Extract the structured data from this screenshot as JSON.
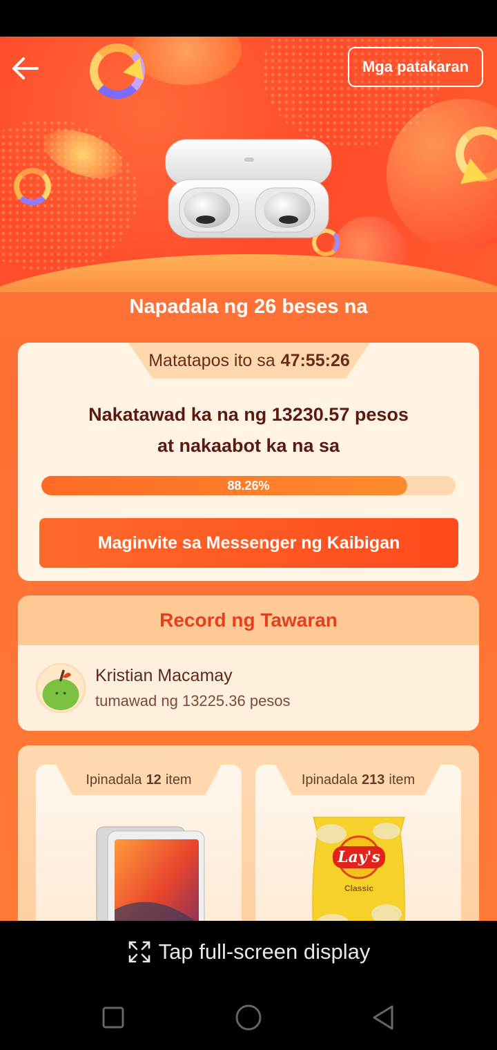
{
  "header": {
    "rules_label": "Mga patakaran"
  },
  "hero": {
    "sent_text": "Napadala ng 26 beses na"
  },
  "bargain": {
    "timer_prefix": "Matatapos ito sa",
    "timer_value": "47:55:26",
    "line1": "Nakatawad ka na ng 13230.57 pesos",
    "line2": "at nakaabot ka na sa",
    "progress_percent": 88.26,
    "progress_label": "88.26%",
    "invite_label": "Maginvite sa Messenger ng Kaibigan"
  },
  "records": {
    "title": "Record ng Tawaran",
    "items": [
      {
        "name": "Kristian Macamay",
        "amount_text": "tumawad ng 13225.36 pesos"
      }
    ]
  },
  "items": [
    {
      "prefix": "Ipinadala",
      "count": "12",
      "suffix": "item",
      "product": "tablet"
    },
    {
      "prefix": "Ipinadala",
      "count": "213",
      "suffix": "item",
      "product": "chips",
      "brand": "Lay's",
      "flavor": "Classic"
    }
  ],
  "overlay": {
    "fullscreen_label": "Tap full-screen display"
  },
  "colors": {
    "accent": "#ff5a24",
    "record_title": "#e2411e",
    "dark_text": "#5a1a10"
  }
}
